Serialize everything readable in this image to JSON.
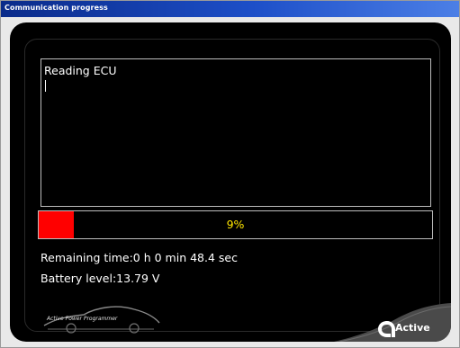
{
  "window": {
    "title": "Communication progress"
  },
  "log": {
    "text": "Reading ECU"
  },
  "progress": {
    "percent": 9,
    "label": "9%",
    "fill_color": "#ff0000",
    "label_color": "#ffe600"
  },
  "status": {
    "remaining_time": "Remaining time:0 h 0 min 48.4 sec",
    "battery_level": "Battery level:13.79 V"
  },
  "branding": {
    "product_label": "Active Power Programmer",
    "logo_text": "Active"
  },
  "icons": {
    "car_outline": "car-outline-icon",
    "logo": "active-logo-icon"
  }
}
